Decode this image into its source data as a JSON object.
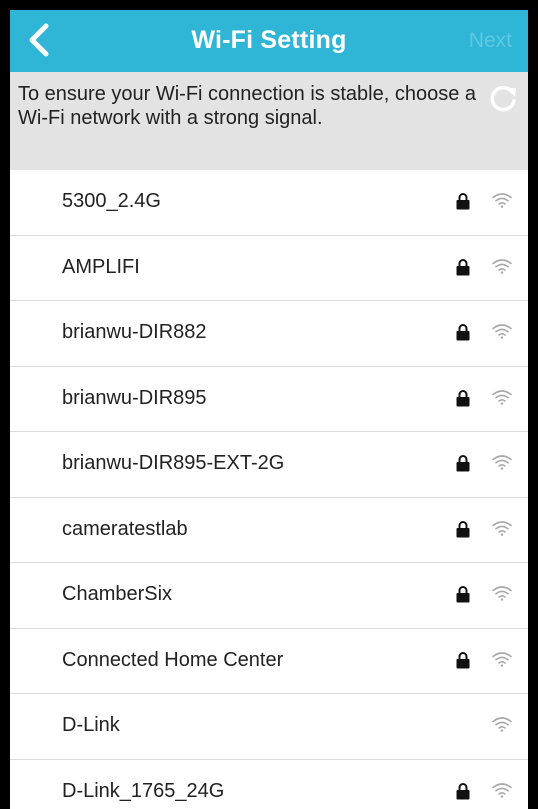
{
  "header": {
    "title": "Wi-Fi Setting",
    "next_label": "Next",
    "back_icon": "chevron-left-icon"
  },
  "notice": {
    "text": "To ensure your Wi-Fi connection is stable, choose a Wi-Fi network with a strong signal.",
    "refresh_icon": "refresh-icon"
  },
  "colors": {
    "header_bg": "#2fb5d6",
    "notice_bg": "#e3e3e3",
    "next_disabled": "#5fc9e2"
  },
  "networks": [
    {
      "ssid": "5300_2.4G",
      "locked": true
    },
    {
      "ssid": "AMPLIFI",
      "locked": true
    },
    {
      "ssid": "brianwu-DIR882",
      "locked": true
    },
    {
      "ssid": "brianwu-DIR895",
      "locked": true
    },
    {
      "ssid": "brianwu-DIR895-EXT-2G",
      "locked": true
    },
    {
      "ssid": "cameratestlab",
      "locked": true
    },
    {
      "ssid": "ChamberSix",
      "locked": true
    },
    {
      "ssid": "Connected Home Center",
      "locked": true
    },
    {
      "ssid": "D-Link",
      "locked": false
    },
    {
      "ssid": "D-Link_1765_24G",
      "locked": true
    }
  ]
}
